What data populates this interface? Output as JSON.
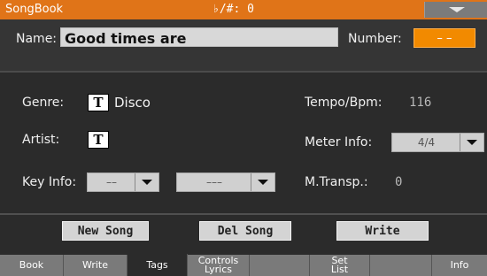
{
  "titlebar": {
    "app": "SongBook",
    "accidentals": "♭/#: 0"
  },
  "name": {
    "label": "Name:",
    "value": "Good times are"
  },
  "number": {
    "label": "Number:",
    "value": "– –"
  },
  "genre": {
    "label": "Genre:",
    "t_icon": "T",
    "value": "Disco"
  },
  "artist": {
    "label": "Artist:",
    "t_icon": "T"
  },
  "key_info": {
    "label": "Key Info:",
    "dropdown1": "––",
    "dropdown2": "–––"
  },
  "tempo": {
    "label": "Tempo/Bpm:",
    "value": "116"
  },
  "meter": {
    "label": "Meter Info:",
    "value": "4/4"
  },
  "transp": {
    "label": "M.Transp.:",
    "value": "0"
  },
  "buttons": {
    "new_song": "New Song",
    "del_song": "Del Song",
    "write": "Write"
  },
  "tabs": [
    {
      "label": "Book"
    },
    {
      "label": "Write"
    },
    {
      "label": "Tags"
    },
    {
      "label1": "Controls",
      "label2": "Lyrics"
    },
    {
      "label": ""
    },
    {
      "label1": "Set",
      "label2": "List"
    },
    {
      "label": ""
    },
    {
      "label": "Info"
    }
  ],
  "colors": {
    "accent": "#e07418",
    "number_field": "#f28a00",
    "background": "#2b2b2b"
  },
  "icons": {
    "menu": "triangle-down",
    "dropdown": "triangle-down"
  }
}
